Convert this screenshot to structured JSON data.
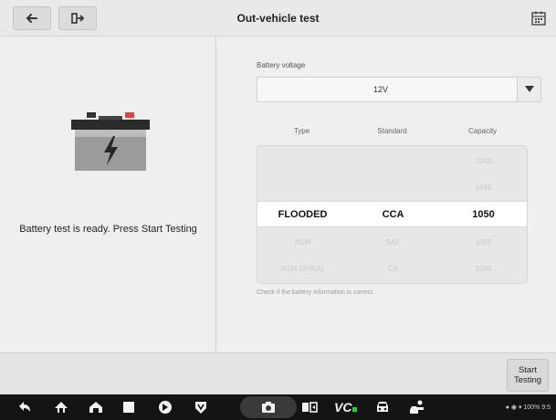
{
  "header": {
    "title": "Out-vehicle test",
    "back_icon": "back-arrow-icon",
    "exit_icon": "exit-icon",
    "calendar_icon": "calendar-icon"
  },
  "left_panel": {
    "battery_icon": "battery-icon",
    "message": "Battery test is ready. Press Start Testing"
  },
  "battery_voltage": {
    "label": "Battery voltage",
    "value": "12V"
  },
  "picker": {
    "columns": [
      "Type",
      "Standard",
      "Capacity"
    ],
    "rows": [
      {
        "type": "",
        "standard": "",
        "capacity": "1040"
      },
      {
        "type": "",
        "standard": "",
        "capacity": "1045"
      },
      {
        "type": "FLOODED",
        "standard": "CCA",
        "capacity": "1050"
      },
      {
        "type": "AGM",
        "standard": "SAE",
        "capacity": "1055"
      },
      {
        "type": "AGM SPIRAL",
        "standard": "CA",
        "capacity": "1060"
      }
    ],
    "selected_index": 2,
    "note": "Check if the battery information is correct."
  },
  "actions": {
    "start_line1": "Start",
    "start_line2": "Testing"
  },
  "system_bar": {
    "status": "100% 9:5"
  },
  "colors": {
    "background": "#efefef",
    "system_bar": "#141414",
    "accent_red": "#e0443c"
  }
}
